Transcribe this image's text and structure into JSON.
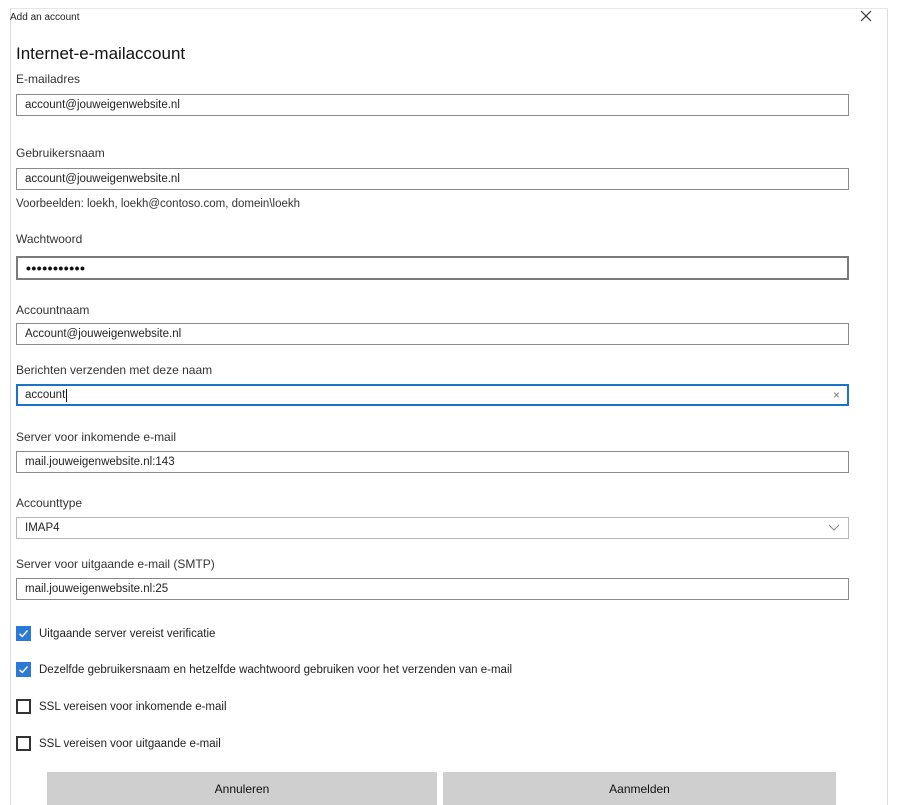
{
  "window": {
    "title": "Add an account",
    "close_icon": "×"
  },
  "heading": "Internet-e-mailaccount",
  "fields": {
    "email": {
      "label": "E-mailadres",
      "value": "account@jouweigenwebsite.nl"
    },
    "username": {
      "label": "Gebruikersnaam",
      "value": "account@jouweigenwebsite.nl",
      "hint": "Voorbeelden: loekh, loekh@contoso.com, domein\\loekh"
    },
    "password": {
      "label": "Wachtwoord",
      "value": "•••••••••••"
    },
    "account_name": {
      "label": "Accountnaam",
      "value": "Account@jouweigenwebsite.nl"
    },
    "sender_name": {
      "label": "Berichten verzenden met deze naam",
      "value": "account",
      "clear_icon": "×"
    },
    "incoming_server": {
      "label": "Server voor inkomende e-mail",
      "value": "mail.jouweigenwebsite.nl:143"
    },
    "account_type": {
      "label": "Accounttype",
      "value": "IMAP4"
    },
    "outgoing_server": {
      "label": "Server voor uitgaande e-mail (SMTP)",
      "value": "mail.jouweigenwebsite.nl:25"
    }
  },
  "checkboxes": [
    {
      "label": "Uitgaande server vereist verificatie",
      "checked": true
    },
    {
      "label": "Dezelfde gebruikersnaam en hetzelfde wachtwoord gebruiken voor het verzenden van e-mail",
      "checked": true
    },
    {
      "label": "SSL vereisen voor inkomende e-mail",
      "checked": false
    },
    {
      "label": "SSL vereisen voor uitgaande e-mail",
      "checked": false
    }
  ],
  "buttons": {
    "cancel": "Annuleren",
    "sign_in": "Aanmelden"
  },
  "colors": {
    "accent": "#2b7ad8",
    "focus_border": "#1a73c8",
    "button_bg": "#cfcfcf"
  }
}
